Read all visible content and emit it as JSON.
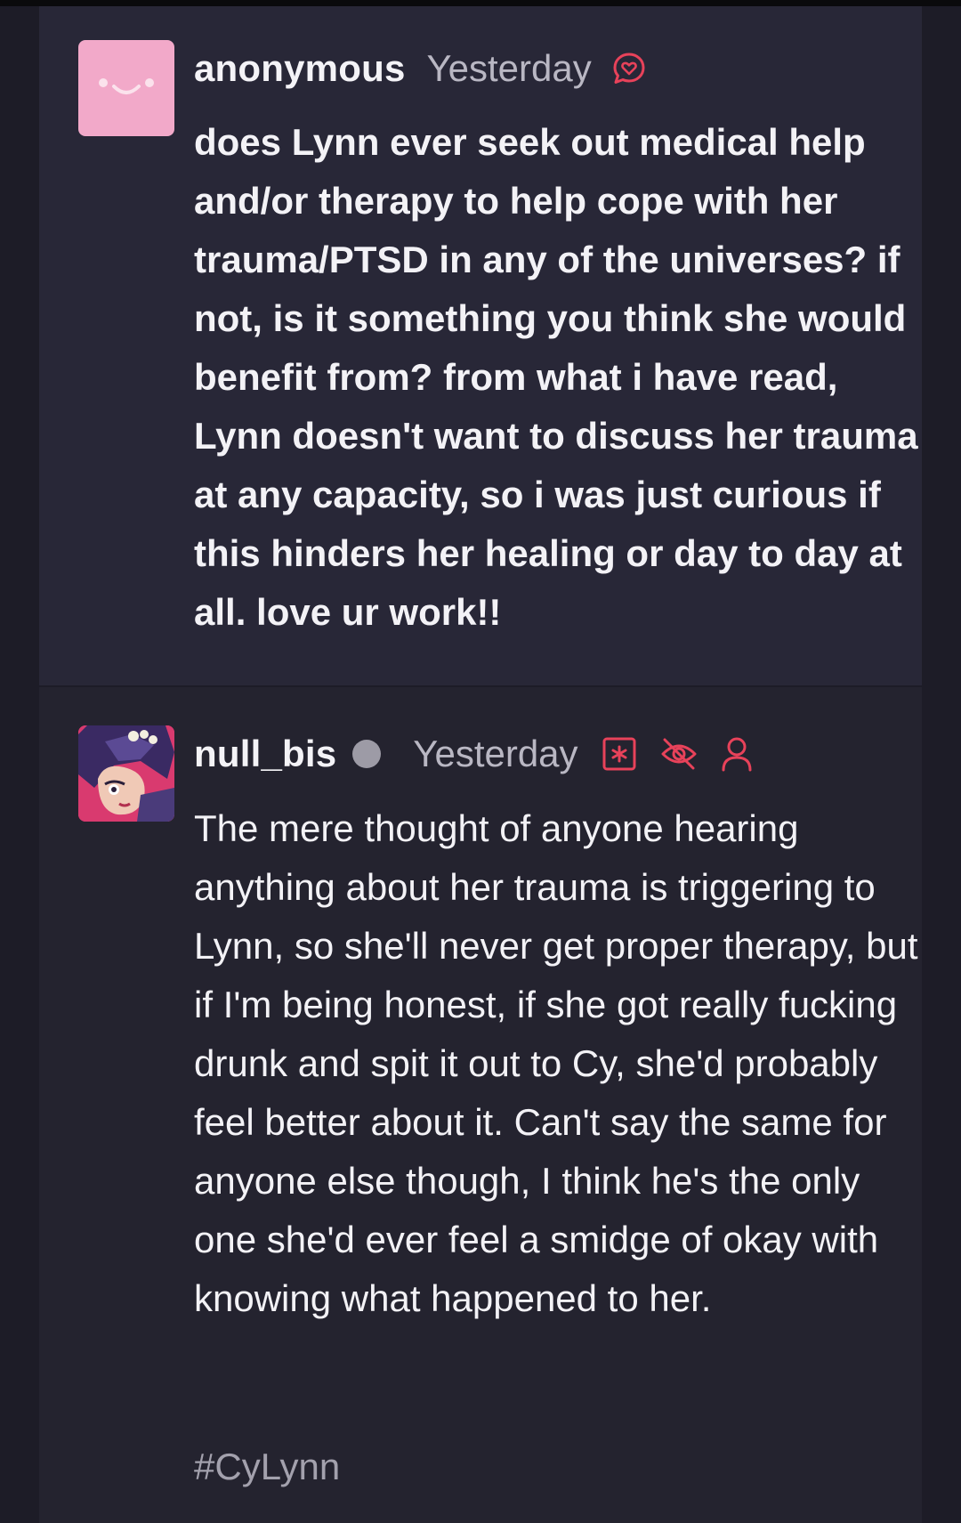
{
  "ask": {
    "username": "anonymous",
    "timestamp": "Yesterday",
    "icon": "ask-heart-icon",
    "text": "does Lynn ever seek out medical help and/or therapy to help cope with her trauma/PTSD in any of the universes? if not, is it something you think she would benefit from? from what i have read, Lynn doesn't want to discuss her trauma at any capacity, so i was just curious if this hinders her healing or day to day at all. love ur work!!"
  },
  "answer": {
    "username": "null_bis",
    "timestamp": "Yesterday",
    "icons": [
      "asterisk-box-icon",
      "eye-off-icon",
      "user-icon"
    ],
    "text": "The mere thought of anyone hearing anything about her trauma is triggering to Lynn, so she'll never get proper therapy, but if I'm being honest, if she got really fucking drunk and spit it out to Cy, she'd probably feel better about it. Can't say the same for anyone else though, I think he's the only one she'd ever feel a smidge of okay with knowing what happened to her.",
    "tag": "#CyLynn"
  },
  "colors": {
    "background": "#1d1c27",
    "card": "#282737",
    "accent": "#e8425a",
    "text": "#f3f2f6",
    "muted": "#b9b7c3",
    "avatar_anon": "#f2a9c9"
  }
}
